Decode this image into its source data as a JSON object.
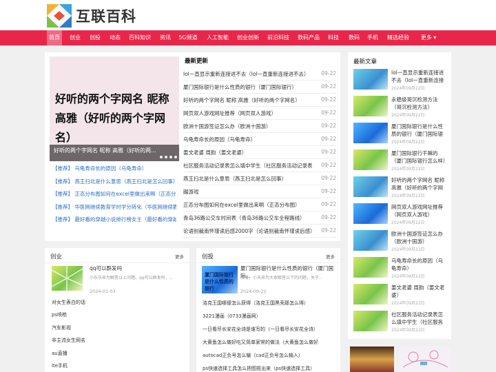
{
  "site": {
    "logo_text": "互联百科"
  },
  "nav": [
    "首页",
    "创业",
    "创投",
    "动态",
    "百科知识",
    "资讯",
    "5G频道",
    "人工智能",
    "创业创新",
    "前沿科技",
    "数码产品",
    "科技",
    "数码",
    "手机",
    "精选经验",
    "更多 ▾"
  ],
  "slider": {
    "big_text": "好听的两个字网名 昵称 高雅（好听的两个字网名）",
    "caption": "好听的两个字网名 昵称 高雅（好听的两..."
  },
  "recommended": [
    "【推荐】 乌龟寿命长的原因（乌龟寿命）",
    "【推荐】 燕王扫北是什么意思（燕王扫北是怎么回事）",
    "【推荐】 正态分布图如何在excel里做出来啊（正态分布图）",
    "【推荐】 华医网继续教育学时学分转化（华医网继续教育）",
    "【推荐】 最好看的穿越小说排行榜女主（最好看的穿越小..."
  ],
  "latest": {
    "title": "最新更新",
    "items": [
      {
        "t": "lol一直显示重新连接进不去（lol一直重新连接进不去）",
        "d": "09-22"
      },
      {
        "t": "厦门国际银行是什么性质的银行（厦门国际银行）",
        "d": "09-22"
      },
      {
        "t": "好听的两个字网名 昵称 高雅（好听的两个字网名）",
        "d": "09-22"
      },
      {
        "t": "网页双人游戏网址推荐（网页双人游戏）",
        "d": "09-22"
      },
      {
        "t": "欧洲十国游签证怎么办（欧洲十国游）",
        "d": "09-22"
      },
      {
        "t": "乌龟寿命长的原因（乌龟寿命）",
        "d": "09-22"
      },
      {
        "t": "姜文老婆 周韵（姜文老婆）",
        "d": "09-22"
      },
      {
        "t": "社区服务活动记录表怎么填中学生（社区服务活动记录表",
        "d": "09-22"
      },
      {
        "t": "燕王扫北是什么意思（燕王扫北是怎么回事）",
        "d": "09-22"
      },
      {
        "t": "蹑游戏",
        "d": "09-22"
      },
      {
        "t": "正态分布图如何在excel里做出来啊（正态分布图）",
        "d": "09-22"
      },
      {
        "t": "青岛36路公交车时间表（青岛36路公交车全程路线）",
        "d": "09-22"
      },
      {
        "t": "论语别裁南怀瑾读后感2000字（论语别裁南怀瑾读后感）",
        "d": "09-22"
      }
    ]
  },
  "chuangye": {
    "title": "创业",
    "more": "更多",
    "feature": {
      "title": "qq可以群发吗",
      "summary": "小乐乐来为解答以上问题。qq可以群发吗，...",
      "date": "2024-01-03"
    },
    "items": [
      "对女生表白的话",
      "ps喷枪",
      "汽车影视",
      "非主流女生网名",
      "au直播",
      "lte手机"
    ]
  },
  "chuangtou": {
    "title": "创投",
    "more": "更多",
    "feature": {
      "thumb_text": "厦门国际银行是什么性质的银行",
      "title": "厦门国际银行是什么性质的银行（厦门国际...",
      "summary": "哈喽，小天来为大家解答以下的问题，关于...",
      "date": "2024-09-22"
    },
    "items": [
      "洛克王国哪便怎么获得（洛克王国黑壳那怎么得）",
      "3221漫画（0733漫画网）",
      "一日看尽长安花全诗是谁写的（一日看尽长安花全诗）",
      "大黄鱼怎么做好吃又简单家常的做法（大黄鱼怎么做好",
      "autocad正负号怎么输（cad正负号怎么输入）",
      "ps快速选择工具怎么把图抠出来（ps快速选择工具）"
    ]
  },
  "latest_articles": {
    "title": "最新文章",
    "items": [
      {
        "t": "lol一直显示重新连接进不去（lol一直重新连接进不去）",
        "d": "2024年09月22日"
      },
      {
        "t": "永稳级哥沉检测方法（哥沉检测方法）",
        "d": "2024年09月22日"
      },
      {
        "t": "厦门国际银行是什么性质的银行（厦门国际银行）",
        "d": "2024年09月22日"
      },
      {
        "t": "厦门国际银行干嘛的（厦门国际银行怎么样）",
        "d": "2024年09月22日"
      },
      {
        "t": "好听的两个字网名 昵称 高雅（好听的两个字网名）",
        "d": "2024年09月22日"
      },
      {
        "t": "网页双人游戏网址推荐（网页双人游戏）",
        "d": "2024年09月22日"
      },
      {
        "t": "欧洲十国游签证怎么办（欧洲十国游）",
        "d": "2024年09月22日"
      },
      {
        "t": "乌龟寿命长的原因（乌龟寿命）",
        "d": "2024年09月22日"
      },
      {
        "t": "姜文老婆 周韵（姜文老婆）",
        "d": "2024年09月22日"
      },
      {
        "t": "社区服务活动记录表怎么填中学生（社区服务活动记录表）",
        "d": "2024年09月22日"
      }
    ]
  },
  "colors": {
    "brand": "#e8264a",
    "link": "#2a6fc1"
  }
}
